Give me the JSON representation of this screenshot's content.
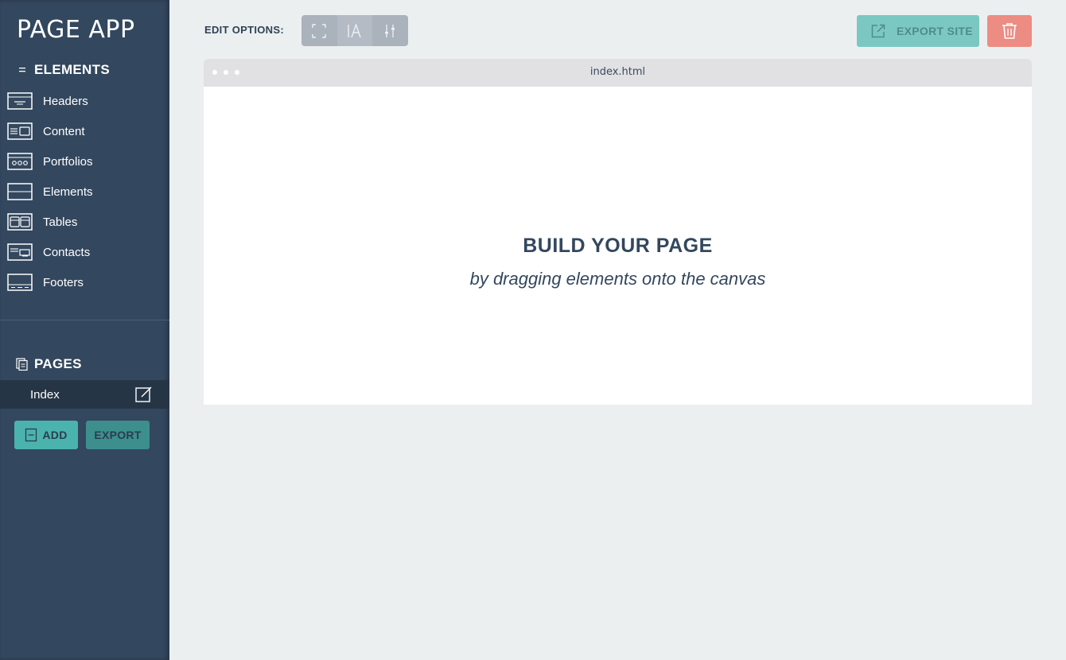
{
  "app": {
    "title": "PAGE APP"
  },
  "sidebar": {
    "elements_heading": "ELEMENTS",
    "items": [
      {
        "label": "Headers",
        "icon": "headers-block-icon"
      },
      {
        "label": "Content",
        "icon": "content-block-icon"
      },
      {
        "label": "Portfolios",
        "icon": "portfolios-block-icon"
      },
      {
        "label": "Elements",
        "icon": "elements-block-icon"
      },
      {
        "label": "Tables",
        "icon": "tables-block-icon"
      },
      {
        "label": "Contacts",
        "icon": "contacts-block-icon"
      },
      {
        "label": "Footers",
        "icon": "footers-block-icon"
      }
    ],
    "pages_heading": "PAGES",
    "pages": [
      {
        "label": "Index"
      }
    ],
    "add_label": "ADD",
    "export_label": "EXPORT"
  },
  "toolbar": {
    "edit_options_label": "EDIT OPTIONS:",
    "tools": [
      "select-frame-icon",
      "text-style-icon",
      "sliders-icon"
    ],
    "export_site_label": "EXPORT SITE"
  },
  "canvas": {
    "filename": "index.html",
    "title": "BUILD YOUR PAGE",
    "subtitle": "by dragging elements onto the canvas"
  },
  "colors": {
    "sidebar_bg": "#33475e",
    "accent_teal": "#4bb3ad",
    "export_site_bg": "#7bc8c2",
    "delete_bg": "#ec8c83",
    "page_bg": "#eceff0"
  }
}
